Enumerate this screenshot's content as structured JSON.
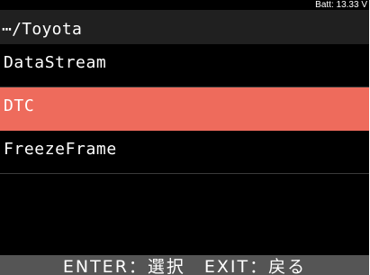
{
  "status": {
    "battery": "Batt: 13.33 V"
  },
  "header": {
    "path": "⋯/Toyota"
  },
  "menu": {
    "items": [
      {
        "label": "DataStream",
        "selected": false
      },
      {
        "label": "DTC",
        "selected": true
      },
      {
        "label": "FreezeFrame",
        "selected": false
      },
      {
        "label": "",
        "selected": false
      }
    ]
  },
  "footer": {
    "hint": "ENTER：選択　EXIT：戻る"
  },
  "colors": {
    "selected_bg": "#ee6b5c",
    "screen_bg": "#000000",
    "header_bg": "#202020",
    "footer_bg": "#555555"
  }
}
